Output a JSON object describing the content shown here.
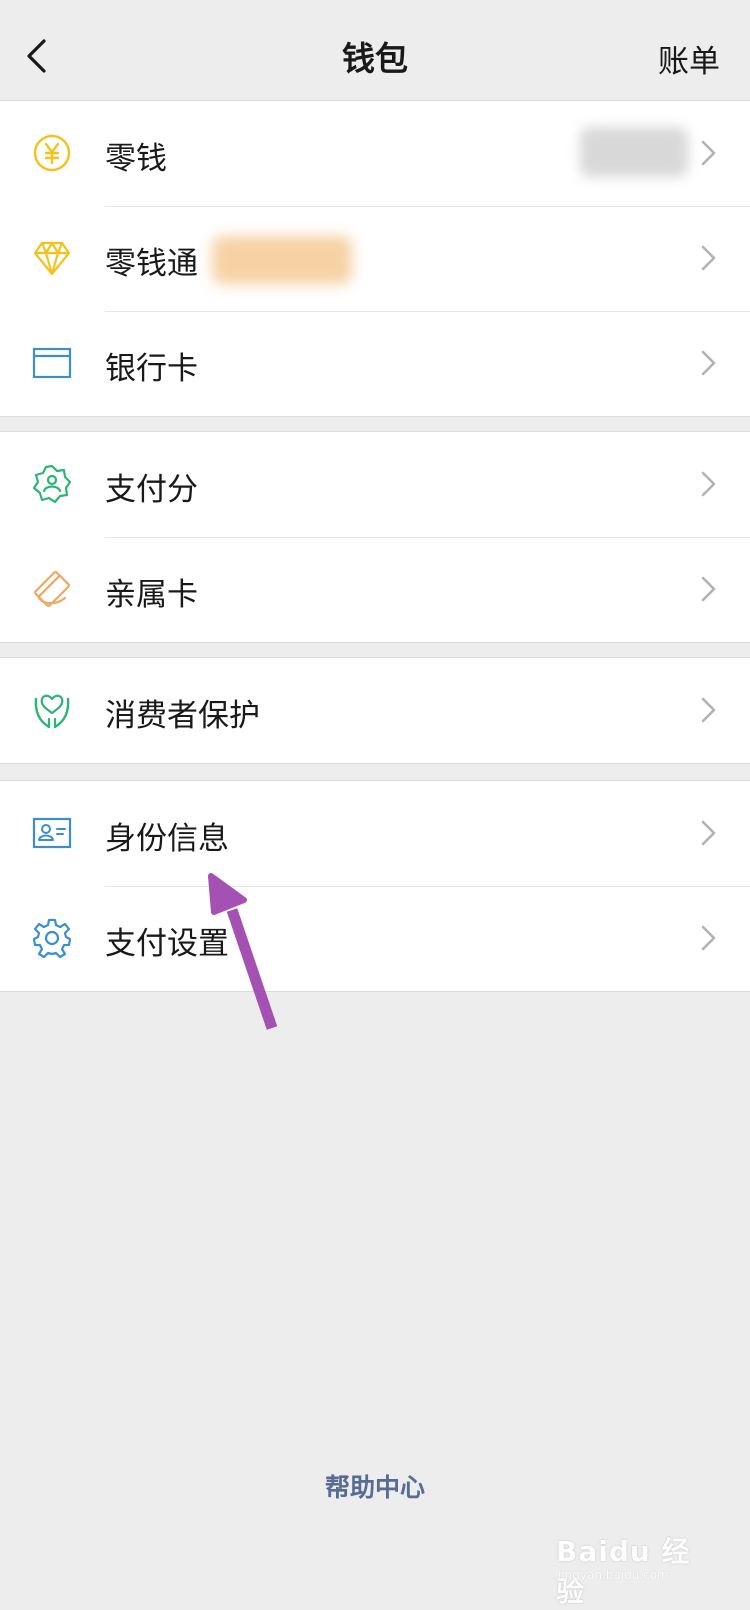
{
  "nav": {
    "title": "钱包",
    "right_action": "账单"
  },
  "groups": [
    {
      "items": [
        {
          "label": "零钱",
          "icon": "coin-yen-icon",
          "icon_color": "#f5c21b",
          "value": "blurred"
        },
        {
          "label": "零钱通",
          "icon": "diamond-icon",
          "icon_color": "#f5c21b",
          "value": "blurred"
        },
        {
          "label": "银行卡",
          "icon": "bank-card-icon",
          "icon_color": "#3b8fcf"
        }
      ]
    },
    {
      "items": [
        {
          "label": "支付分",
          "icon": "pay-score-badge-icon",
          "icon_color": "#2bb673"
        },
        {
          "label": "亲属卡",
          "icon": "family-card-icon",
          "icon_color": "#f0a760"
        }
      ]
    },
    {
      "items": [
        {
          "label": "消费者保护",
          "icon": "protect-hands-icon",
          "icon_color": "#2bb673"
        }
      ]
    },
    {
      "items": [
        {
          "label": "身份信息",
          "icon": "id-card-icon",
          "icon_color": "#3b8fcf"
        },
        {
          "label": "支付设置",
          "icon": "gear-icon",
          "icon_color": "#3b8fcf"
        }
      ]
    }
  ],
  "footer": {
    "help_link": "帮助中心"
  },
  "watermark": {
    "text": "Baidu 经验",
    "subtext": "jingyan.baidu.com"
  },
  "colors": {
    "background": "#ededed",
    "link": "#576b95",
    "arrow": "#a550b3"
  }
}
